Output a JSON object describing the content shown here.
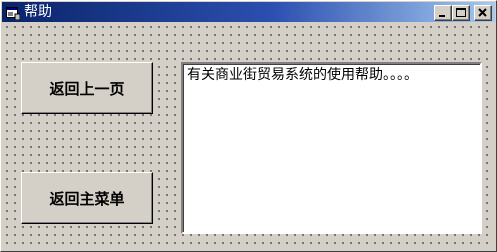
{
  "window": {
    "title": "帮助",
    "icon": "app-window-icon",
    "controls": {
      "minimize": "minimize-icon",
      "maximize": "maximize-icon",
      "close": "close-icon"
    }
  },
  "buttons": {
    "back_label": "返回上一页",
    "main_menu_label": "返回主菜单"
  },
  "help": {
    "text": "有关商业街贸易系统的使用帮助。。。。"
  },
  "colors": {
    "title_bar_start": "#0a246a",
    "title_bar_end": "#a6caf0",
    "face": "#d4d0c8"
  }
}
